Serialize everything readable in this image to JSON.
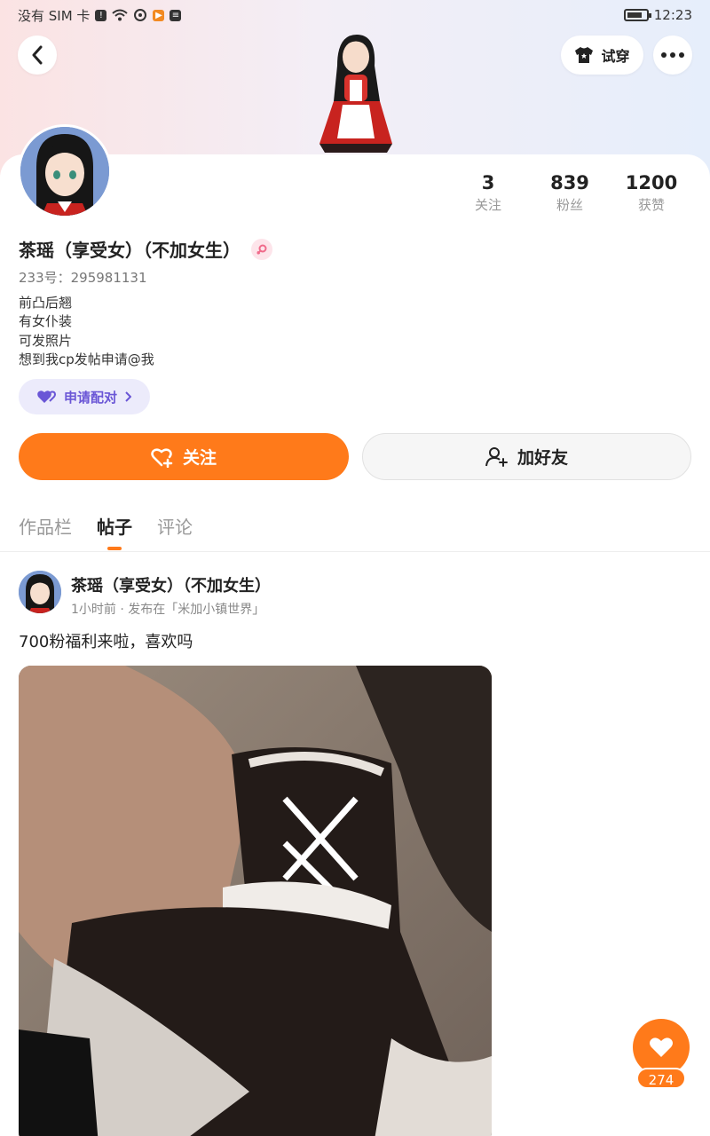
{
  "status_bar": {
    "carrier": "没有 SIM 卡",
    "time": "12:23",
    "battery_level": 0.8
  },
  "header": {
    "try_on_label": "试穿",
    "back_icon": "chevron-left-icon",
    "more_icon": "ellipsis-icon",
    "try_on_icon": "shirt-icon"
  },
  "profile": {
    "stats": [
      {
        "value": "3",
        "label": "关注"
      },
      {
        "value": "839",
        "label": "粉丝"
      },
      {
        "value": "1200",
        "label": "获赞"
      }
    ],
    "name": "茶瑶（享受女）（不加女生）",
    "uid": "233号：295981131",
    "bio": [
      "前凸后翘",
      "有女仆装",
      "可发照片",
      "想到我cp发帖申请@我"
    ],
    "pair_button": "申请配对",
    "follow_button": "关注",
    "add_friend_button": "加好友"
  },
  "tabs": [
    {
      "label": "作品栏",
      "active": false
    },
    {
      "label": "帖子",
      "active": true
    },
    {
      "label": "评论",
      "active": false
    }
  ],
  "post": {
    "author": "茶瑶（享受女）（不加女生）",
    "meta": "1小时前 · 发布在「米加小镇世界」",
    "text": "700粉福利来啦，喜欢吗",
    "like_count": "274"
  },
  "colors": {
    "accent": "#ff7a1a",
    "pair_bg": "#ecebfb",
    "pair_text": "#6a56d6"
  }
}
